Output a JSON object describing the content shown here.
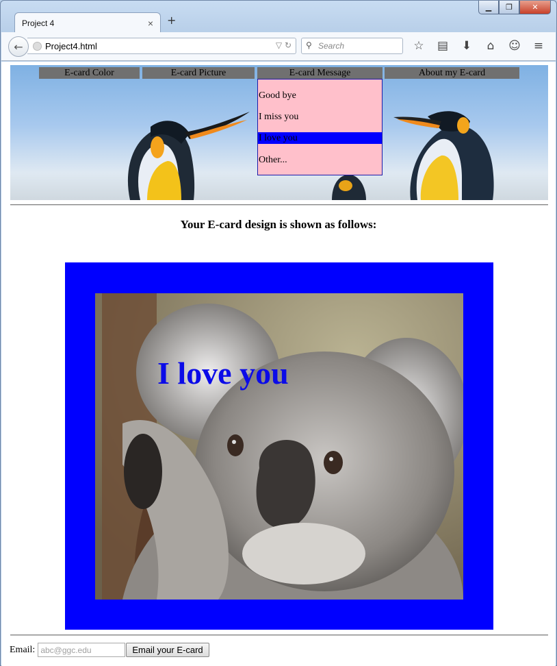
{
  "browser": {
    "tab_title": "Project 4",
    "tab_close": "×",
    "new_tab": "+",
    "url": "Project4.html",
    "search_placeholder": "Search"
  },
  "nav": {
    "items": [
      {
        "label": "E-card Color"
      },
      {
        "label": "E-card Picture"
      },
      {
        "label": "E-card Message"
      },
      {
        "label": "About my E-card"
      }
    ],
    "dropdown": [
      "Good bye",
      "I miss you",
      "I love you",
      "Other..."
    ],
    "dropdown_selected": "I love you"
  },
  "main": {
    "heading": "Your E-card design is shown as follows:",
    "card_message": "I love you",
    "card_color": "#0000ff",
    "picture": "koala"
  },
  "email": {
    "label": "Email:",
    "placeholder": "abc@ggc.edu",
    "button": "Email your E-card"
  },
  "colors": {
    "dropdown_bg": "#ffc0cb",
    "menu_bg": "#707070",
    "highlight": "#0000ff"
  }
}
